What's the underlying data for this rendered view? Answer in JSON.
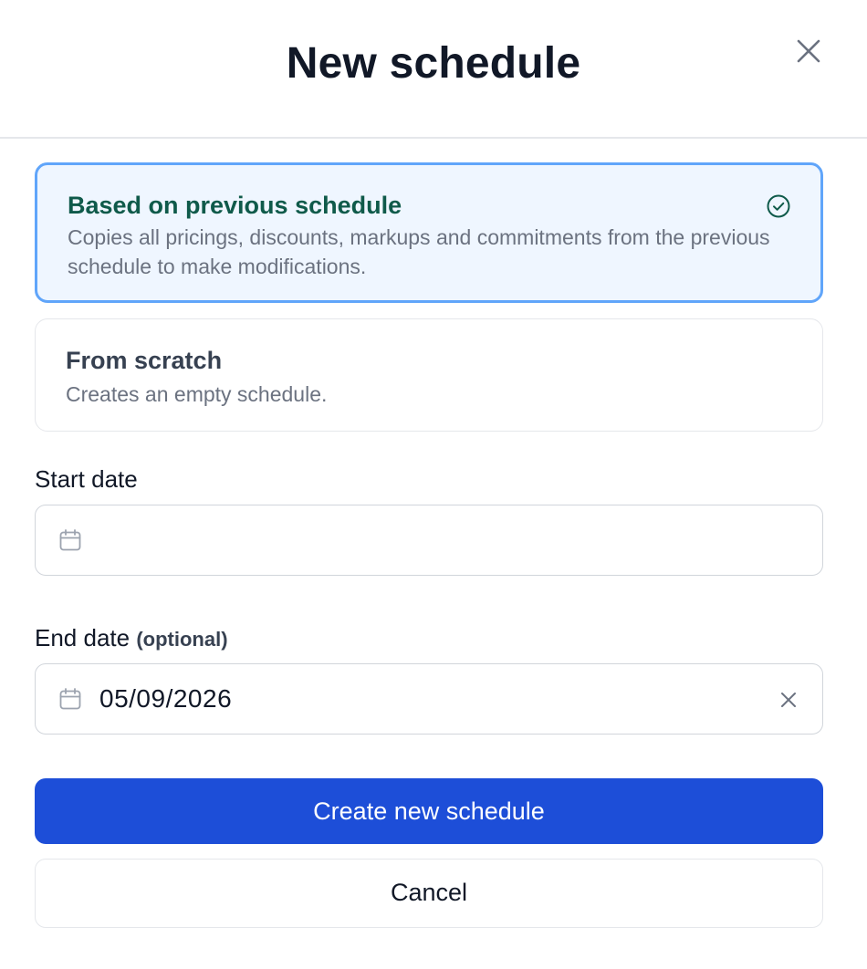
{
  "dialog": {
    "title": "New schedule",
    "close_icon": "close-icon"
  },
  "options": [
    {
      "title": "Based on previous schedule",
      "description": "Copies all pricings, discounts, markups and commitments from the previous schedule to make modifications.",
      "selected": true,
      "icon": "check-circle-icon"
    },
    {
      "title": "From scratch",
      "description": "Creates an empty schedule.",
      "selected": false
    }
  ],
  "start_date": {
    "label": "Start date",
    "value": "",
    "icon": "calendar-icon"
  },
  "end_date": {
    "label": "End date",
    "optional_label": "(optional)",
    "value": "05/09/2026",
    "icon": "calendar-icon",
    "clear_icon": "clear-icon"
  },
  "actions": {
    "primary_label": "Create new schedule",
    "secondary_label": "Cancel"
  },
  "colors": {
    "primary": "#1d4ed8",
    "selected_border": "#60a5fa",
    "selected_background": "#eff6ff",
    "selected_title": "#0f5a4a"
  }
}
